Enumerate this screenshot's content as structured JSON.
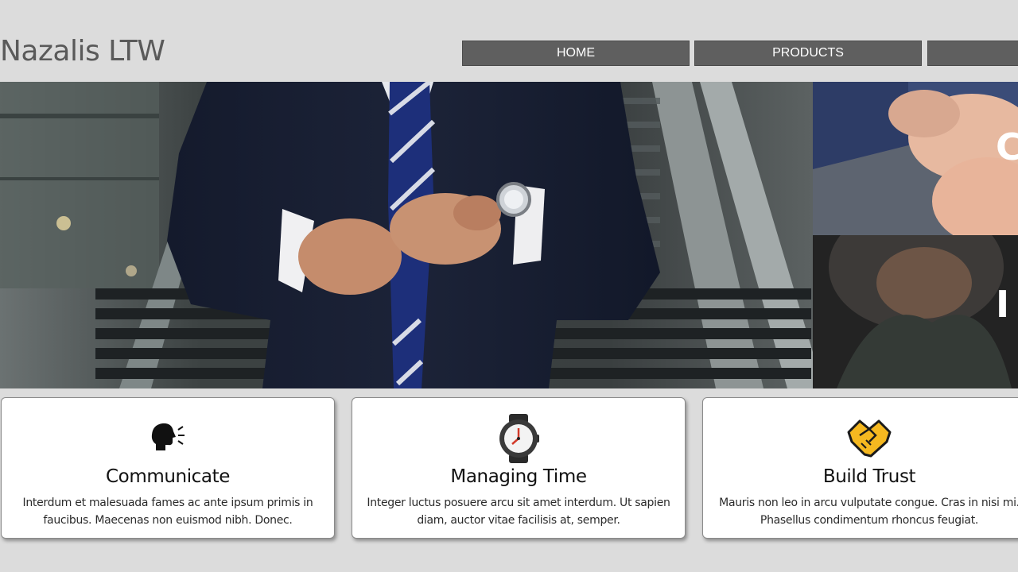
{
  "header": {
    "brand": "Nazalis LTW",
    "nav": [
      {
        "label": "HOME"
      },
      {
        "label": "PRODUCTS"
      },
      {
        "label": ""
      }
    ]
  },
  "hero": {
    "side_top_caption": "C",
    "side_bottom_caption": "I"
  },
  "cards": [
    {
      "icon": "speaking-head-icon",
      "title": "Communicate",
      "text": "Interdum et malesuada fames ac ante ipsum primis in faucibus. Maecenas non euismod nibh. Donec."
    },
    {
      "icon": "wristwatch-icon",
      "title": "Managing Time",
      "text": "Integer luctus posuere arcu sit amet interdum. Ut sapien diam, auctor vitae facilisis at, semper."
    },
    {
      "icon": "handshake-icon",
      "title": "Build Trust",
      "text": "Mauris non leo in arcu vulputate congue. Cras in nisi mi. Phasellus condimentum rhoncus feugiat."
    }
  ],
  "colors": {
    "background": "#dcdcdc",
    "nav_button": "#5f5f5f",
    "brand_text": "#5a5a5a",
    "handshake": "#f5b820"
  }
}
